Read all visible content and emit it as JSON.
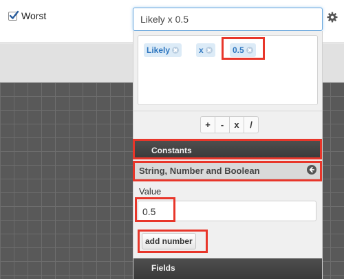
{
  "checkbox": {
    "label": "Worst",
    "checked": true
  },
  "formula": {
    "value": "Likely x 0.5"
  },
  "icons": {
    "settings": "gear-icon",
    "token_remove": "remove-circle-icon",
    "collapse": "chevron-left-circle-icon",
    "check": "check-icon"
  },
  "tokens": [
    "Likely",
    "x",
    "0.5"
  ],
  "operators": [
    "+",
    "-",
    "x",
    "/"
  ],
  "sections": {
    "constants": "Constants",
    "string_number_boolean": "String, Number and Boolean",
    "fields": "Fields"
  },
  "value_field": {
    "label": "Value",
    "value": "0.5"
  },
  "add_button": {
    "label": "add number"
  },
  "colors": {
    "highlight": "#e8362a",
    "token_bg": "#dcebf7",
    "token_text": "#2f77c0",
    "dark_bar": "#444444"
  }
}
